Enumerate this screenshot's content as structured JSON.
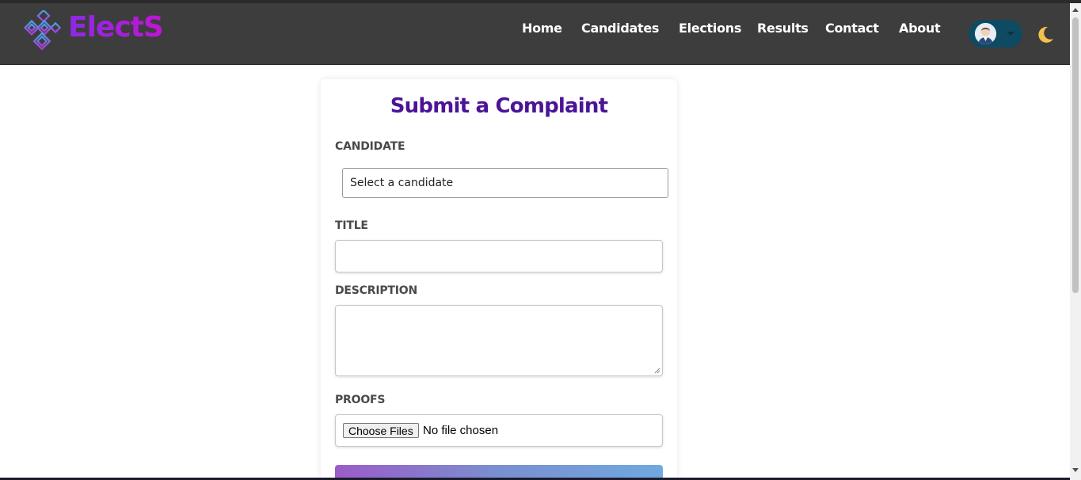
{
  "app": {
    "brand": "ElectS"
  },
  "nav": {
    "links": [
      "Home",
      "Candidates",
      "Elections",
      "Results",
      "Contact",
      "About"
    ]
  },
  "form": {
    "title": "Submit a Complaint",
    "candidate_label": "CANDIDATE",
    "candidate_selected": "Select a candidate",
    "title_label": "TITLE",
    "title_value": "",
    "description_label": "DESCRIPTION",
    "description_value": "",
    "proofs_label": "PROOFS",
    "file_button": "Choose Files",
    "file_status": "No file chosen"
  },
  "icons": {
    "logo": "diamond-logo-icon",
    "theme": "moon-icon",
    "avatar": "user-avatar-icon",
    "caret": "chevron-down-icon"
  },
  "colors": {
    "navbar": "#3d3d3d",
    "brand_gradient": [
      "#8a2be2",
      "#c214d6"
    ],
    "title": "#4b1496",
    "moon": "#f4c04e",
    "profile_pill": "#0f4a63"
  }
}
